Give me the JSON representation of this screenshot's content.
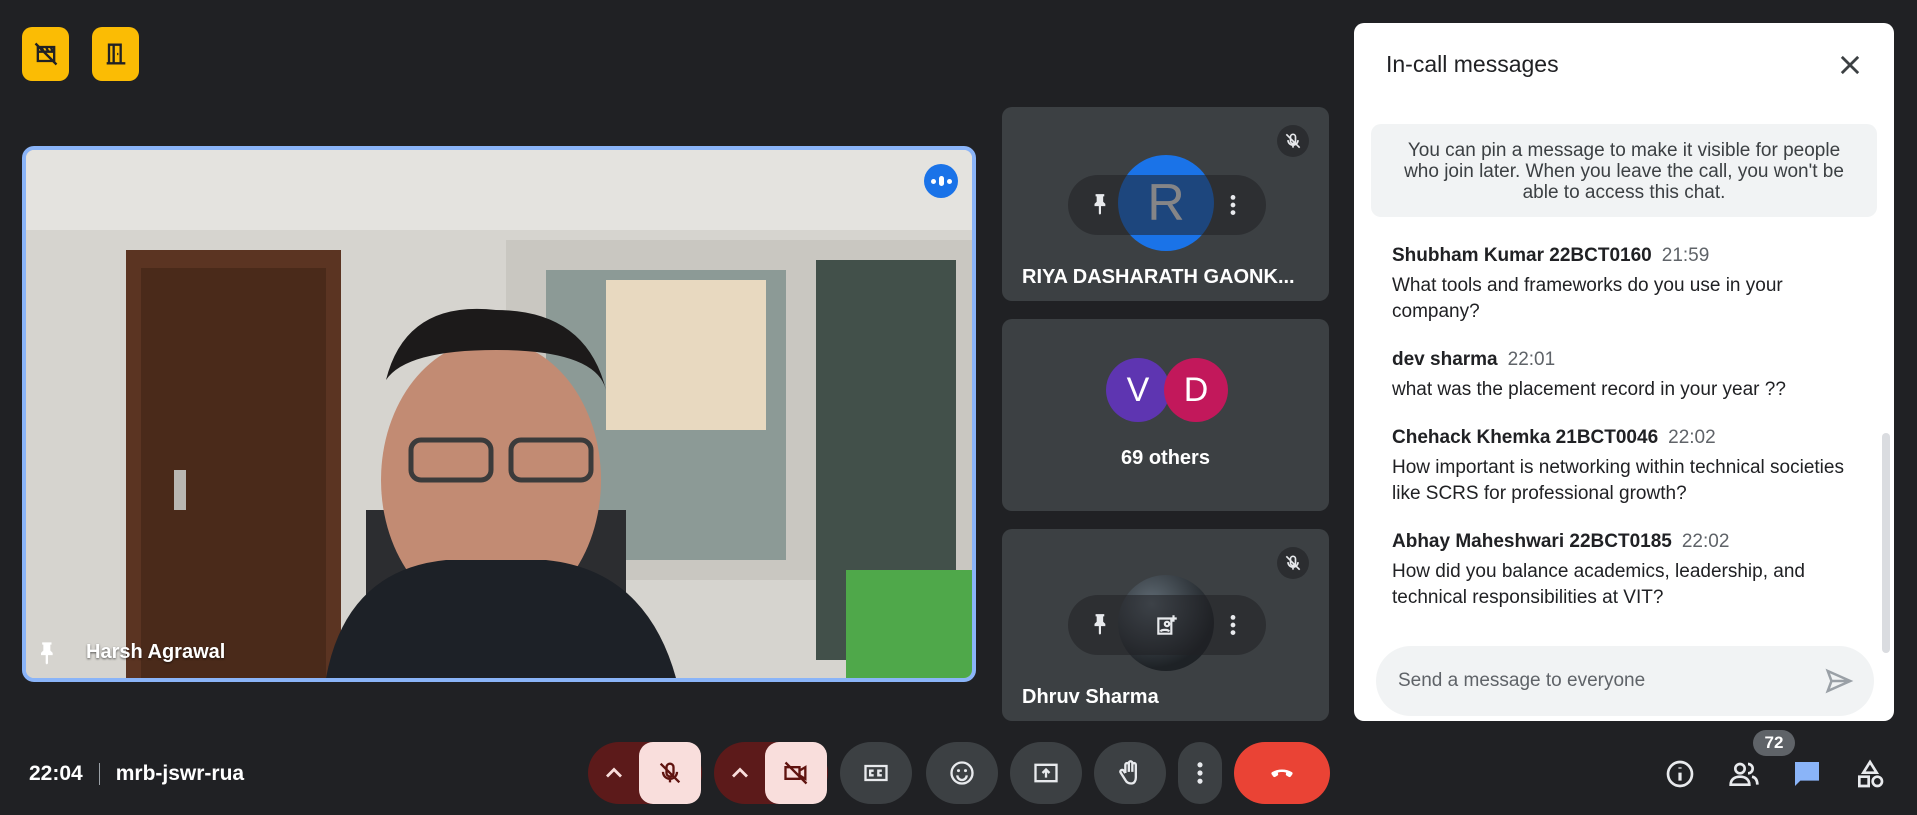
{
  "top_badges": [
    {
      "icon": "no-movie-icon"
    },
    {
      "icon": "door-icon"
    }
  ],
  "main_tile": {
    "name": "Harsh Agrawal",
    "pin_icon": "pin-icon",
    "speaking_icon": "speaking-indicator-icon"
  },
  "side_tiles": [
    {
      "name": "RIYA DASHARATH GAONK...",
      "avatar_letter": "R",
      "muted": true
    },
    {
      "label": "69 others",
      "avatars": [
        {
          "letter": "V",
          "color": "#5e35b1"
        },
        {
          "letter": "D",
          "color": "#c2185b"
        }
      ]
    },
    {
      "name": "Dhruv Sharma",
      "muted": true
    }
  ],
  "chat": {
    "title": "In-call messages",
    "pin_note": "You can pin a message to make it visible for people who join later. When you leave the call, you won't be able to access this chat.",
    "messages": [
      {
        "author": "Shubham Kumar 22BCT0160",
        "time": "21:59",
        "text": "What tools and frameworks do you use in your company?"
      },
      {
        "author": "dev sharma",
        "time": "22:01",
        "text": "what was the placement record in your year ??"
      },
      {
        "author": "Chehack Khemka 21BCT0046",
        "time": "22:02",
        "text": "How important is networking within technical societies like SCRS for professional growth?"
      },
      {
        "author": "Abhay Maheshwari 22BCT0185",
        "time": "22:02",
        "text": "How did you balance academics, leadership, and technical responsibilities at VIT?"
      }
    ],
    "input_placeholder": "Send a message to everyone"
  },
  "bottom": {
    "time": "22:04",
    "meeting_code": "mrb-jswr-rua",
    "participants_count": "72"
  },
  "colors": {
    "background": "#202124",
    "tile": "#3c4043",
    "accent": "#8ab4f8",
    "leave": "#ea4335",
    "badge": "#fbbc04"
  }
}
